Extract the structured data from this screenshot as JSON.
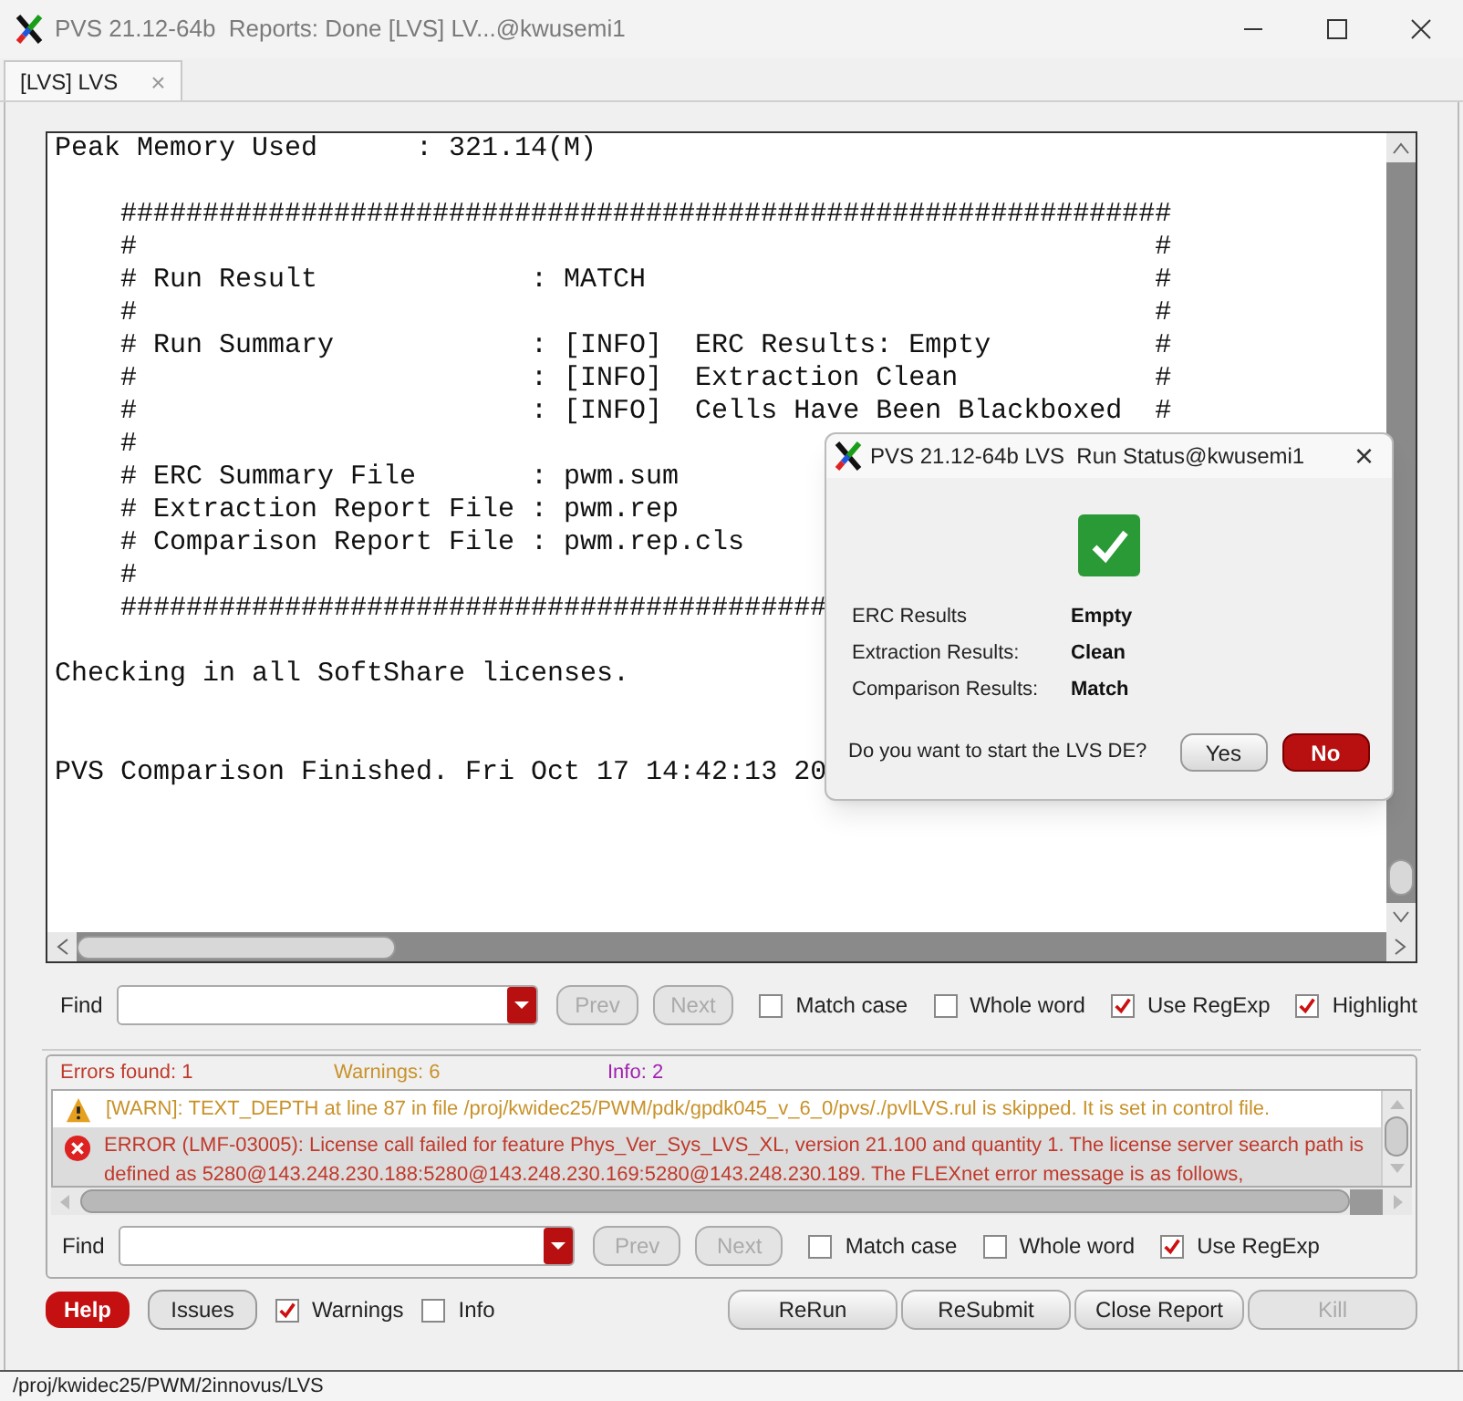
{
  "window": {
    "title": "PVS 21.12-64b  Reports: Done [LVS] LV...@kwusemi1"
  },
  "tabs": [
    {
      "label": "[LVS] LVS",
      "selected": true,
      "close": "×"
    }
  ],
  "log": {
    "lines": [
      {
        "kind": "text",
        "text": "Peak Memory Used      : 321.14(M)"
      },
      {
        "kind": "blank"
      },
      {
        "kind": "text",
        "text": "    ################################################################"
      },
      {
        "kind": "text",
        "text": "    #                                                              #"
      },
      {
        "kind": "text",
        "text": "    # Run Result             : MATCH                               #"
      },
      {
        "kind": "text",
        "text": "    #                                                              #"
      },
      {
        "kind": "text",
        "text": "    # Run Summary            : [INFO]  ERC Results: Empty          #"
      },
      {
        "kind": "text",
        "text": "    #                        : [INFO]  Extraction Clean            #"
      },
      {
        "kind": "text",
        "text": "    #                        : [INFO]  Cells Have Been Blackboxed  #"
      },
      {
        "kind": "text",
        "text": "    #"
      },
      {
        "kind": "text",
        "text": "    # ERC Summary File       : pwm.sum"
      },
      {
        "kind": "text",
        "text": "    # Extraction Report File : pwm.rep"
      },
      {
        "kind": "text",
        "text": "    # Comparison Report File : pwm.rep.cls"
      },
      {
        "kind": "text",
        "text": "    #"
      },
      {
        "kind": "text",
        "text": "    ###########################################"
      },
      {
        "kind": "blank"
      },
      {
        "kind": "text",
        "text": "Checking in all SoftShare licenses."
      },
      {
        "kind": "blank"
      },
      {
        "kind": "blank"
      },
      {
        "kind": "text",
        "text": "PVS Comparison Finished. Fri Oct 17 14:42:13 20"
      }
    ]
  },
  "find_log": {
    "label": "Find",
    "prev": "Prev",
    "next": "Next",
    "options": [
      {
        "label": "Match case",
        "checked": false
      },
      {
        "label": "Whole word",
        "checked": false
      },
      {
        "label": "Use RegExp",
        "checked": true
      },
      {
        "label": "Highlight",
        "checked": true
      }
    ]
  },
  "issues": {
    "counts": [
      {
        "label": "Errors found: 1",
        "color": "#c0392b"
      },
      {
        "label": "Warnings: 6",
        "color": "#c8922a"
      },
      {
        "label": "Info: 2",
        "color": "#a020b0"
      }
    ],
    "messages": [
      {
        "kind": "warning",
        "selected": false,
        "text": "[WARN]: TEXT_DEPTH at line 87 in file /proj/kwidec25/PWM/pdk/gpdk045_v_6_0/pvs/./pvlLVS.rul is skipped. It is set in control file."
      },
      {
        "kind": "error",
        "selected": true,
        "text": "ERROR (LMF-03005): License call failed for feature Phys_Ver_Sys_LVS_XL, version 21.100 and quantity 1. The license server search path is defined as 5280@143.248.230.188:5280@143.248.230.169:5280@143.248.230.189. The FLEXnet error message is as follows,"
      }
    ]
  },
  "find_issues": {
    "label": "Find",
    "prev": "Prev",
    "next": "Next",
    "options": [
      {
        "label": "Match case",
        "checked": false
      },
      {
        "label": "Whole word",
        "checked": false
      },
      {
        "label": "Use RegExp",
        "checked": true
      }
    ]
  },
  "bottom": {
    "help": "Help",
    "issues": "Issues",
    "filters": [
      {
        "label": "Warnings",
        "checked": true
      },
      {
        "label": "Info",
        "checked": false
      }
    ],
    "actions": [
      {
        "label": "ReRun",
        "disabled": false
      },
      {
        "label": "ReSubmit",
        "disabled": false
      },
      {
        "label": "Close Report",
        "disabled": false
      },
      {
        "label": "Kill",
        "disabled": true
      }
    ]
  },
  "status_bar": "/proj/kwidec25/PWM/2innovus/LVS",
  "dialog": {
    "title": "PVS 21.12-64b LVS  Run Status@kwusemi1",
    "close": "×",
    "results": [
      {
        "label": "ERC Results",
        "value": "Empty"
      },
      {
        "label": "Extraction Results:",
        "value": "Clean"
      },
      {
        "label": "Comparison Results:",
        "value": "Match"
      }
    ],
    "question": "Do you want to start the LVS DE?",
    "buttons": [
      {
        "label": "Yes",
        "selected": false
      },
      {
        "label": "No",
        "selected": true
      }
    ]
  }
}
